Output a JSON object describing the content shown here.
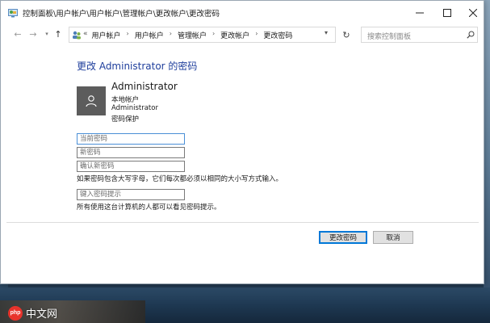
{
  "window": {
    "title": "控制面板\\用户帐户\\用户帐户\\管理帐户\\更改帐户\\更改密码"
  },
  "nav": {
    "breadcrumb_overflow": "«",
    "breadcrumbs": [
      "用户帐户",
      "用户帐户",
      "管理帐户",
      "更改帐户",
      "更改密码"
    ],
    "search_placeholder": "搜索控制面板"
  },
  "content": {
    "heading": "更改 Administrator 的密码",
    "account": {
      "name": "Administrator",
      "type": "本地帐户",
      "group": "Administrator",
      "protection": "密码保护"
    },
    "fields": {
      "current_placeholder": "当前密码",
      "new_placeholder": "新密码",
      "confirm_placeholder": "确认新密码",
      "hint_placeholder": "键入密码提示"
    },
    "case_note": "如果密码包含大写字母，它们每次都必须以相同的大小写方式输入。",
    "hint_note": "所有使用这台计算机的人都可以看见密码提示。"
  },
  "buttons": {
    "change": "更改密码",
    "cancel": "取消"
  },
  "watermark": {
    "logo": "php",
    "text": "中文网"
  },
  "colors": {
    "heading": "#1e3e9c",
    "avatar_bg": "#5c5c5c",
    "focus_border": "#4a8fd6",
    "primary_button_border": "#0078d7"
  }
}
